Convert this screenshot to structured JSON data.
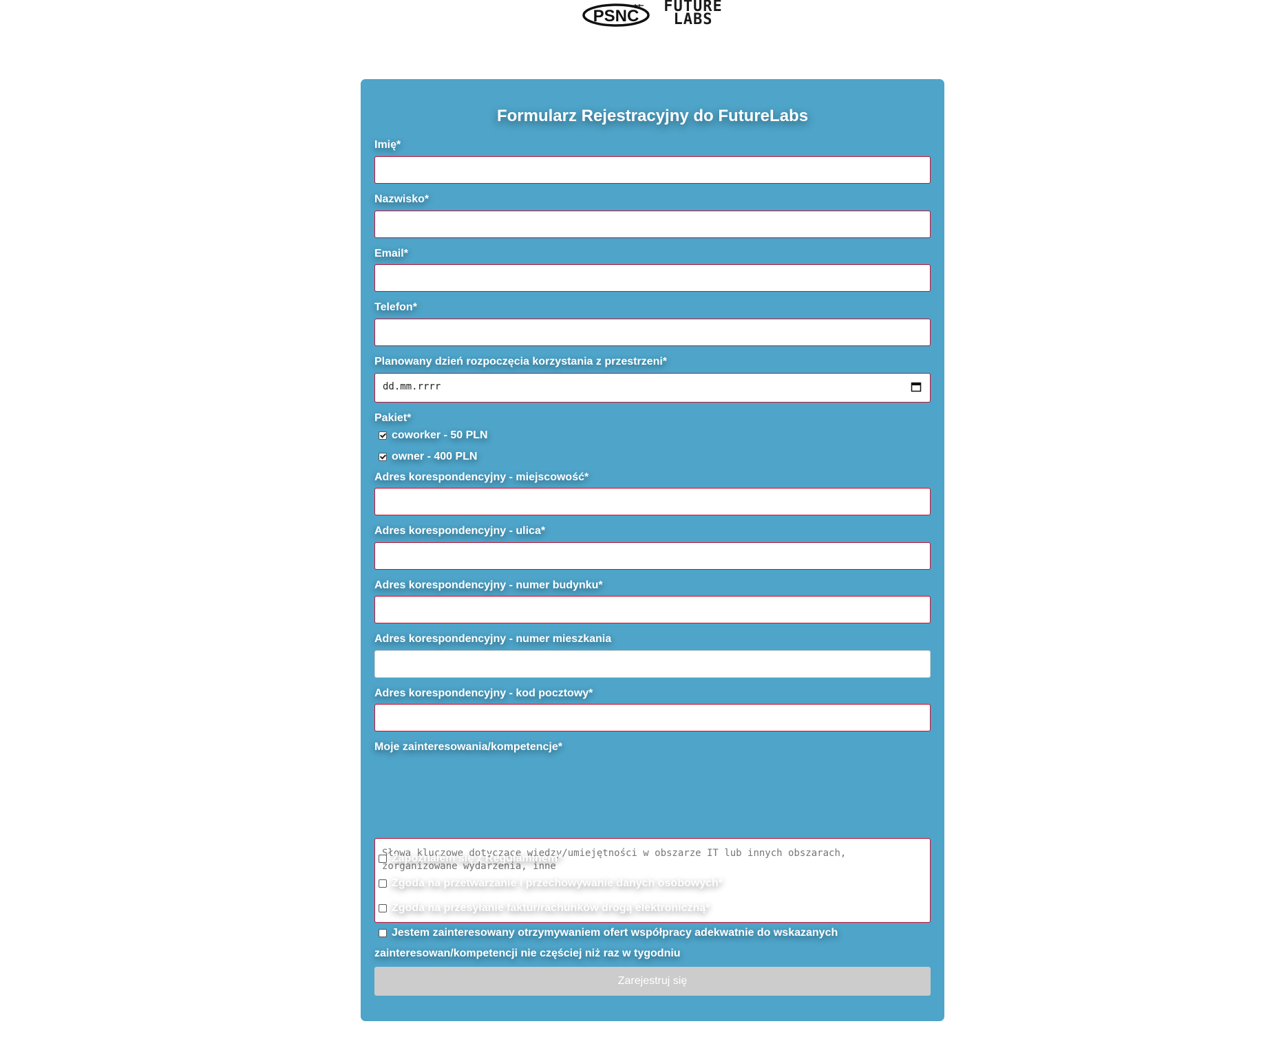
{
  "logos": {
    "psnc": "PSNC",
    "future_labs_line1": "FUTURE",
    "future_labs_line2": "LABS"
  },
  "form": {
    "title": "Formularz Rejestracyjny do FutureLabs",
    "fields": {
      "imie": "Imię*",
      "nazwisko": "Nazwisko*",
      "email": "Email*",
      "telefon": "Telefon*",
      "data_start": "Planowany dzień rozpoczęcia korzystania z przestrzeni*",
      "data_placeholder": "dd.mm.rrrr",
      "pakiet": "Pakiet*",
      "miejscowosc": "Adres korespondencyjny - miejscowość*",
      "ulica": "Adres korespondencyjny - ulica*",
      "numer_budynku": "Adres korespondencyjny - numer budynku*",
      "numer_mieszkania": "Adres korespondencyjny - numer mieszkania",
      "kod_pocztowy": "Adres korespondencyjny - kod pocztowy*",
      "zainteresowania": "Moje zainteresowania/kompetencje*",
      "zainteresowania_placeholder": "Słowa kluczowe dotyczące wiedzy/umiejętności w obszarze IT lub innych obszarach, zorganizowane wydarzenia, inne"
    },
    "packages": [
      {
        "label": "coworker - 50 PLN",
        "checked": true
      },
      {
        "label": "owner - 400 PLN",
        "checked": true
      }
    ],
    "consents": [
      {
        "label": "Zapoznałem się z Regulaminem*",
        "checked": false
      },
      {
        "label": "Zgoda na przetwarzanie i przechowywanie danych osobowych*",
        "checked": false
      },
      {
        "label": "Zgoda na przesyłanie faktur/rachunków drogą elektroniczną*",
        "checked": false
      },
      {
        "label_line1": "Jestem zainteresowany otrzymywaniem ofert współpracy adekwatnie do wskazanych",
        "label_line2": "zainteresowan/kompetencji nie częściej niż raz w tygodniu",
        "checked": false
      }
    ],
    "submit_label": "Zarejestruj się"
  },
  "colors": {
    "card_bg": "#4ea4c9",
    "invalid_border": "#c8102e",
    "submit_disabled": "#cccccc"
  }
}
